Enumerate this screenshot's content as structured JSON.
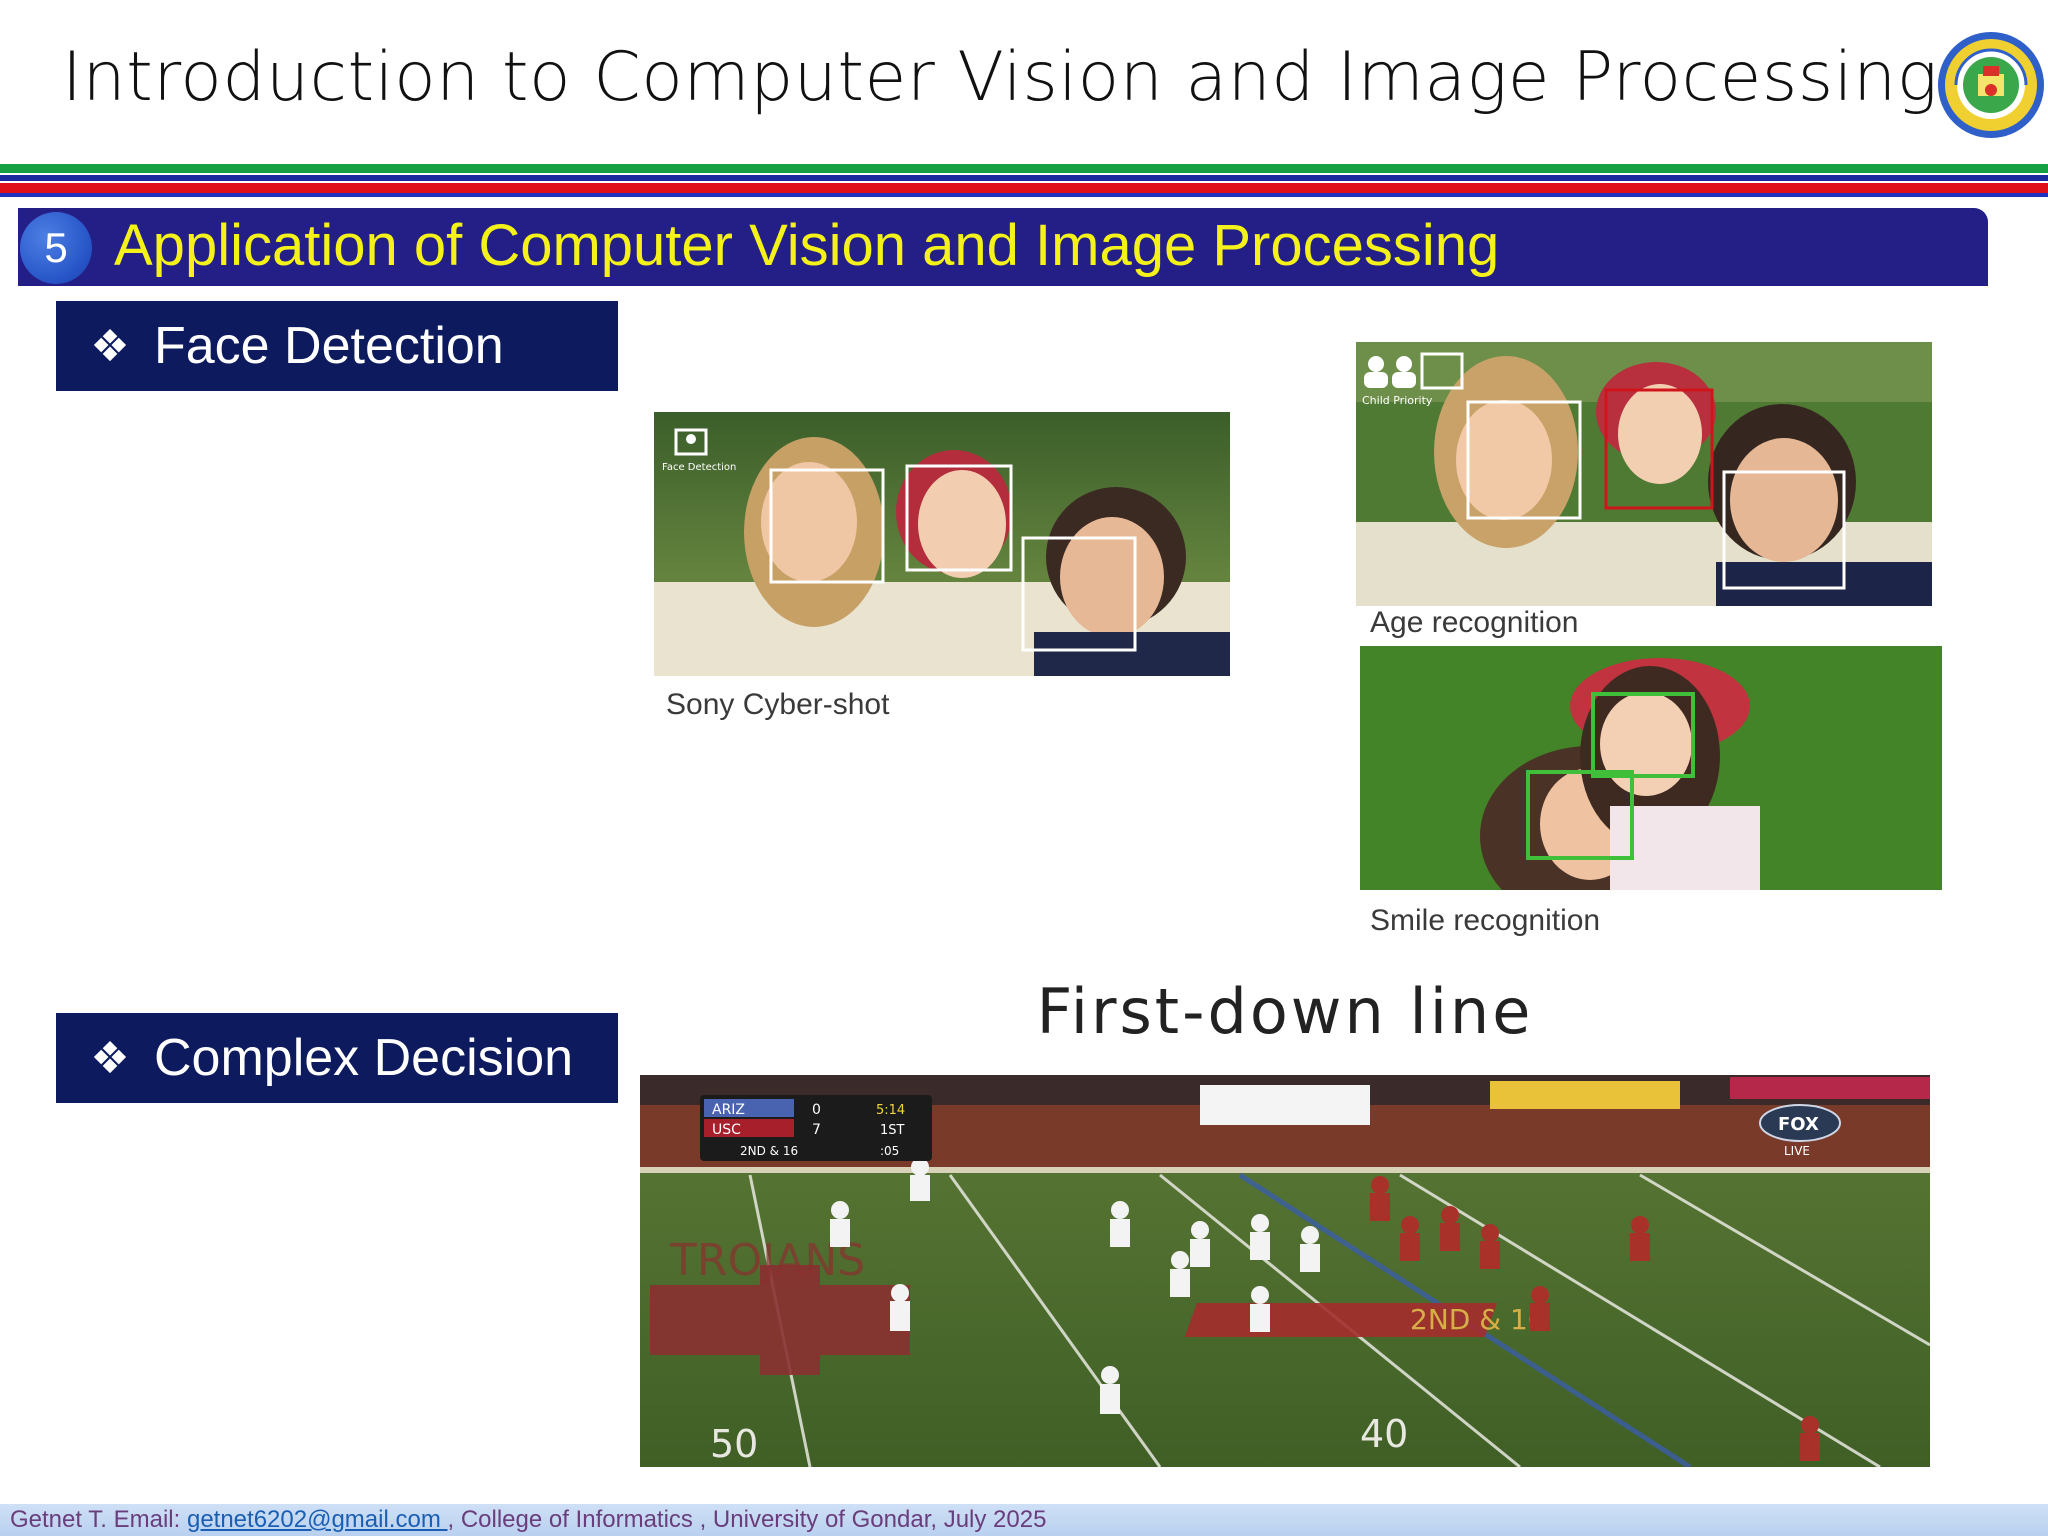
{
  "header": {
    "title": "Introduction to Computer Vision and Image Processing"
  },
  "section": {
    "number": "5",
    "title": "Application of Computer Vision and Image Processing"
  },
  "topics": [
    {
      "label": "Face Detection",
      "icon": "diamond-bullet-icon"
    },
    {
      "label": "Complex Decision",
      "icon": "diamond-bullet-icon"
    }
  ],
  "images": {
    "sony_caption": "Sony Cyber-shot",
    "sony_overlay": "Face Detection",
    "age_caption": "Age recognition",
    "age_overlay": "Child Priority",
    "smile_caption": "Smile recognition",
    "football_heading": "First-down line",
    "scoreboard": {
      "team1": "ARIZ",
      "score1": "0",
      "clock": "5:14",
      "team2": "USC",
      "score2": "7",
      "quarter": "1ST",
      "down": "2ND & 16",
      "play_clock": ":05"
    },
    "broadcaster": "FOX",
    "broadcast_status": "LIVE",
    "field_marker": "2ND & 16",
    "yard_50": "50",
    "yard_40": "40"
  },
  "footer": {
    "author": "Getnet T. Email: ",
    "email": "getnet6202@gmail.com ",
    "rest": ", College of Informatics , University of Gondar, July 2025"
  },
  "colors": {
    "banner_bg": "#231f86",
    "banner_text": "#f5f21a",
    "topic_bg": "#0d1b5e",
    "stripe_green": "#17a043",
    "stripe_red": "#e0101a",
    "stripe_blue": "#1b2a9c",
    "face_box": "#ffffff",
    "age_box": "#d0141b",
    "smile_box": "#3fbf3a"
  },
  "logo": {
    "name": "university-of-gondar-logo",
    "text": "University of Gondar"
  }
}
